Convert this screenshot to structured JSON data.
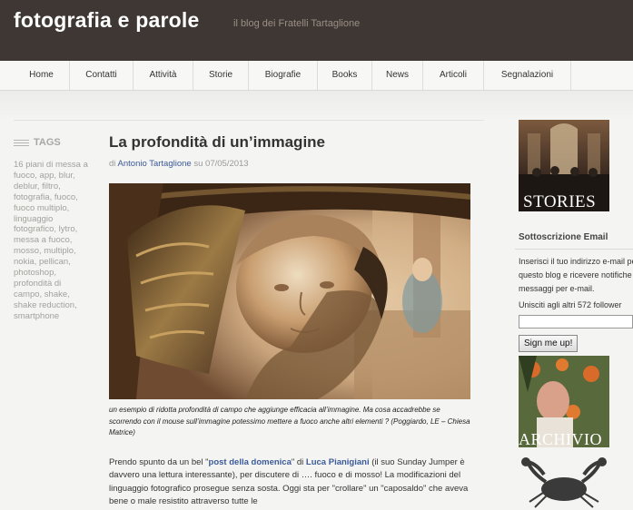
{
  "header": {
    "title": "fotografia e parole",
    "description": "il blog dei Fratelli Tartaglione"
  },
  "nav": {
    "items": [
      "Home",
      "Contatti",
      "Attività",
      "Storie",
      "Biografie",
      "Books",
      "News",
      "Articoli",
      "Segnalazioni"
    ]
  },
  "tags": {
    "heading": "TAGS",
    "items": [
      "16 piani di messa a fuoco",
      "app",
      "blur",
      "deblur",
      "filtro",
      "fotografia",
      "fuoco",
      "fuoco multiplo",
      "linguaggio fotografico",
      "lytro",
      "messa a fuoco",
      "mosso",
      "multiplo",
      "nokia",
      "pellican",
      "photoshop",
      "profondità di campo",
      "shake",
      "shake reduction",
      "smartphone"
    ]
  },
  "post": {
    "title": "La profondità di un’immagine",
    "byline_prefix": "di",
    "author": "Antonio Tartaglione",
    "byline_mid": "su",
    "date": "07/05/2013",
    "caption": "un esempio di ridotta profondità di campo che aggiunge efficacia all’immagine. Ma cosa accadrebbe se scorrendo con il mouse sull’immagine potessimo mettere a fuoco anche altri elementi ? (Poggiardo, LE – Chiesa Matrice)",
    "body_1": "Prendo spunto da un bel \"",
    "link_1": "post della domenica",
    "body_2": "\"  di ",
    "link_2": "Luca Pianigiani",
    "body_3": " (il suo Sunday Jumper è davvero una lettura interessante), per discutere di …. fuoco e di mosso! La modificazioni del linguaggio fotografico prosegue senza sosta. Oggi sta per \"crollare\" un \"caposaldo\" che aveva bene o male resistito attraverso tutte le"
  },
  "sidebar": {
    "stories_label": "STORIES",
    "subscribe_title": "Sottoscrizione Email",
    "subscribe_lines": [
      "Inserisci il tuo indirizzo e-mail per iscriverti a",
      "questo blog e ricevere notifiche dei nuovi",
      "messaggi per e-mail."
    ],
    "followers_text": "Unisciti agli altri 572 follower",
    "email_placeholder": "",
    "signup_label": "Sign me up!",
    "archive_label": "ARCHIVIO"
  },
  "colors": {
    "header_bg": "#3f3733",
    "link": "#3b5a98",
    "tag_text": "#a1a19c"
  }
}
